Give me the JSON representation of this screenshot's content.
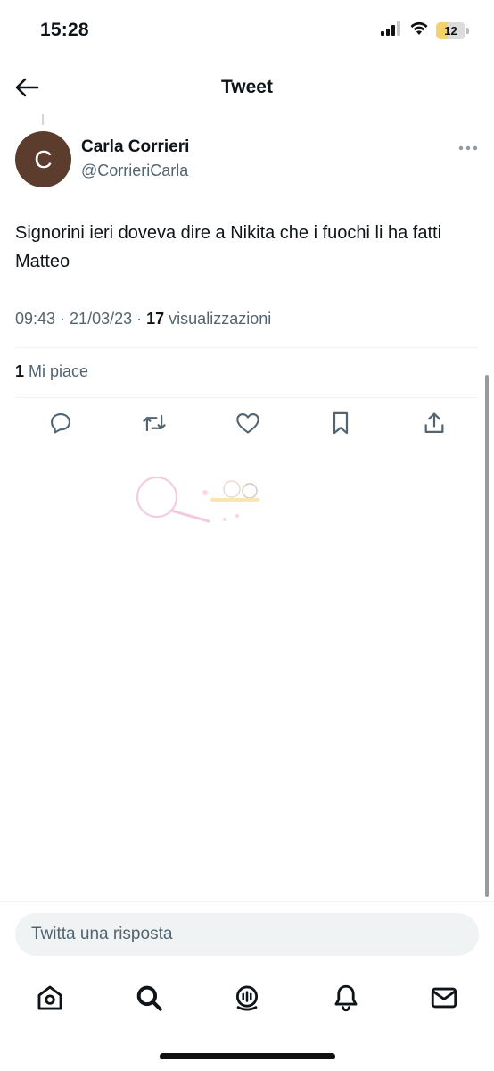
{
  "status_bar": {
    "time": "15:28",
    "battery": "12"
  },
  "header": {
    "title": "Tweet"
  },
  "author": {
    "avatar_letter": "C",
    "avatar_color": "#5c3c2d",
    "name": "Carla Corrieri",
    "handle": "@CorrieriCarla"
  },
  "tweet": {
    "text": "Signorini ieri doveva dire a Nikita che i fuochi li ha fatti Matteo",
    "time": "09:43",
    "date": "21/03/23",
    "views_count": "17",
    "views_label": "visualizzazioni"
  },
  "stats": {
    "likes_count": "1",
    "likes_label": "Mi piace"
  },
  "actions": [
    "reply-icon",
    "retweet-icon",
    "like-icon",
    "bookmark-icon",
    "share-icon"
  ],
  "reply": {
    "placeholder": "Twitta una risposta"
  },
  "tab_bar": [
    "home-icon",
    "search-icon",
    "spaces-icon",
    "notifications-icon",
    "messages-icon"
  ],
  "colors": {
    "text": "#0f1419",
    "secondary": "#536471",
    "divider": "#eff3f4"
  }
}
